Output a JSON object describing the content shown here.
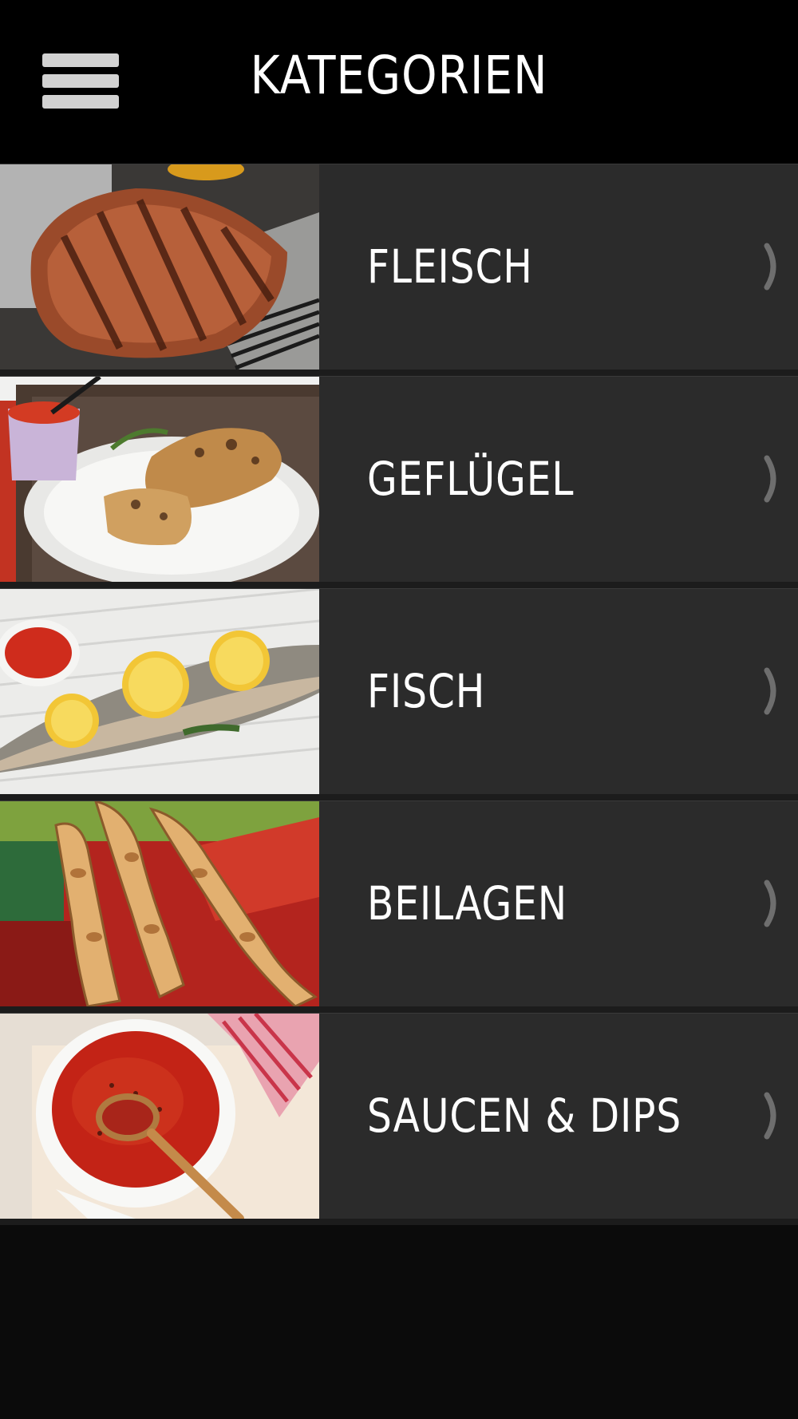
{
  "header": {
    "title": "KATEGORIEN",
    "menu_icon": "hamburger-menu-icon"
  },
  "categories": [
    {
      "label": "FLEISCH"
    },
    {
      "label": "GEFLÜGEL"
    },
    {
      "label": "FISCH"
    },
    {
      "label": "BEILAGEN"
    },
    {
      "label": "SAUCEN & DIPS"
    }
  ],
  "colors": {
    "background": "#0b0b0b",
    "header": "#000000",
    "row": "#2b2b2b",
    "chevron": "#6e6e6e",
    "text": "#ffffff"
  }
}
